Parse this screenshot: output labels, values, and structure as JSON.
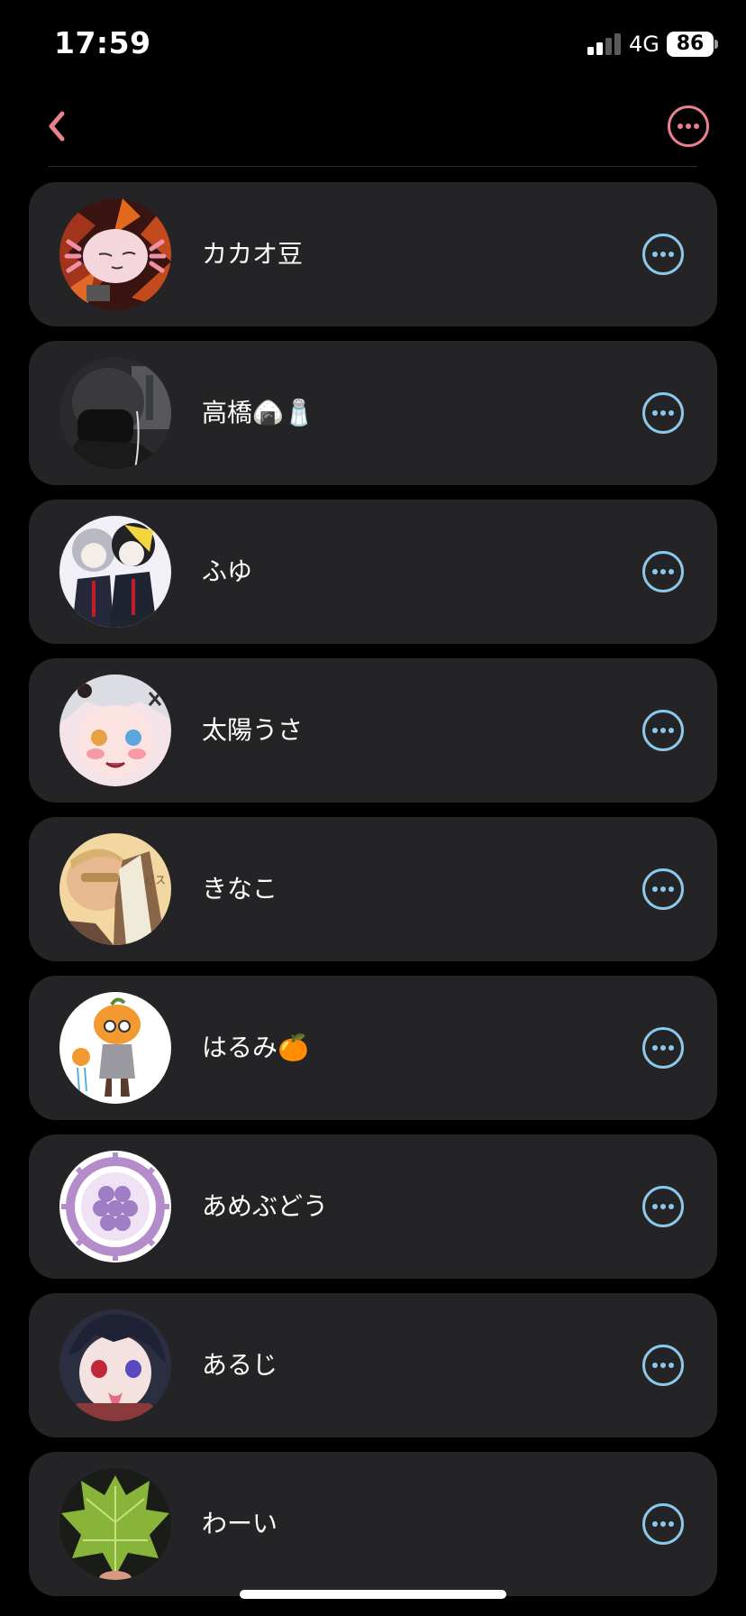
{
  "status_bar": {
    "time": "17:59",
    "network": "4G",
    "battery": "86"
  },
  "nav": {
    "back_icon": "chevron-left-icon",
    "more_icon": "ellipsis-circle-icon"
  },
  "colors": {
    "accent_pink": "#e8808e",
    "row_more_blue": "#8cc8ec",
    "card_background": "#242426",
    "page_background": "#000000"
  },
  "users": [
    {
      "name": "カカオ豆"
    },
    {
      "name": "高橋🍙🧂"
    },
    {
      "name": "ふゆ"
    },
    {
      "name": "太陽うさ"
    },
    {
      "name": "きなこ"
    },
    {
      "name": "はるみ🍊"
    },
    {
      "name": "あめぶどう"
    },
    {
      "name": "あるじ"
    },
    {
      "name": "わーい"
    }
  ]
}
